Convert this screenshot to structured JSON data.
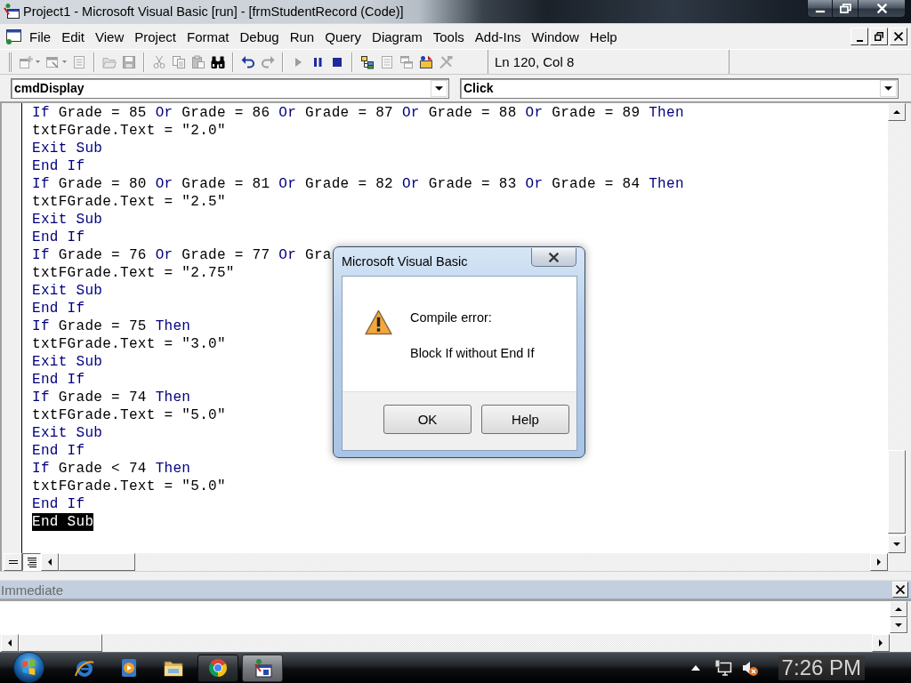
{
  "window": {
    "title": "Project1 - Microsoft Visual Basic [run] - [frmStudentRecord (Code)]"
  },
  "menu_bar": {
    "items": [
      "File",
      "Edit",
      "View",
      "Project",
      "Format",
      "Debug",
      "Run",
      "Query",
      "Diagram",
      "Tools",
      "Add-Ins",
      "Window",
      "Help"
    ]
  },
  "toolbar": {
    "groups": [
      [
        {
          "kind": "add-project",
          "disabled": true,
          "dropdown": true
        },
        {
          "kind": "add-form",
          "disabled": true,
          "dropdown": true
        },
        {
          "kind": "menu-editor",
          "disabled": true
        }
      ],
      [
        {
          "kind": "open",
          "disabled": true
        },
        {
          "kind": "save",
          "disabled": true
        }
      ],
      [
        {
          "kind": "cut",
          "disabled": true
        },
        {
          "kind": "copy",
          "disabled": true
        },
        {
          "kind": "paste",
          "disabled": true
        },
        {
          "kind": "find",
          "disabled": false
        }
      ],
      [
        {
          "kind": "undo",
          "disabled": false
        },
        {
          "kind": "redo",
          "disabled": true
        }
      ],
      [
        {
          "kind": "start",
          "disabled": true
        },
        {
          "kind": "break",
          "disabled": false
        },
        {
          "kind": "end",
          "disabled": false
        }
      ],
      [
        {
          "kind": "project-explorer",
          "disabled": false
        },
        {
          "kind": "properties",
          "disabled": true
        },
        {
          "kind": "form-layout",
          "disabled": true
        },
        {
          "kind": "object-browser",
          "disabled": false
        },
        {
          "kind": "toolbox",
          "disabled": true
        }
      ]
    ],
    "position": "Ln 120, Col 8"
  },
  "code_window": {
    "object": "cmdDisplay",
    "procedure": "Click",
    "lines": [
      {
        "selected": false,
        "parts": [
          {
            "kind": "keyword",
            "text": "If"
          },
          {
            "kind": "plain",
            "text": " Grade = 85 "
          },
          {
            "kind": "keyword",
            "text": "Or"
          },
          {
            "kind": "plain",
            "text": " Grade = 86 "
          },
          {
            "kind": "keyword",
            "text": "Or"
          },
          {
            "kind": "plain",
            "text": " Grade = 87 "
          },
          {
            "kind": "keyword",
            "text": "Or"
          },
          {
            "kind": "plain",
            "text": " Grade = 88 "
          },
          {
            "kind": "keyword",
            "text": "Or"
          },
          {
            "kind": "plain",
            "text": " Grade = 89 "
          },
          {
            "kind": "keyword",
            "text": "Then"
          }
        ]
      },
      {
        "selected": false,
        "parts": [
          {
            "kind": "plain",
            "text": "txtFGrade.Text = \"2.0\""
          }
        ]
      },
      {
        "selected": false,
        "parts": [
          {
            "kind": "keyword",
            "text": "Exit Sub"
          }
        ]
      },
      {
        "selected": false,
        "parts": [
          {
            "kind": "keyword",
            "text": "End If"
          }
        ]
      },
      {
        "selected": false,
        "parts": [
          {
            "kind": "keyword",
            "text": "If"
          },
          {
            "kind": "plain",
            "text": " Grade = 80 "
          },
          {
            "kind": "keyword",
            "text": "Or"
          },
          {
            "kind": "plain",
            "text": " Grade = 81 "
          },
          {
            "kind": "keyword",
            "text": "Or"
          },
          {
            "kind": "plain",
            "text": " Grade = 82 "
          },
          {
            "kind": "keyword",
            "text": "Or"
          },
          {
            "kind": "plain",
            "text": " Grade = 83 "
          },
          {
            "kind": "keyword",
            "text": "Or"
          },
          {
            "kind": "plain",
            "text": " Grade = 84 "
          },
          {
            "kind": "keyword",
            "text": "Then"
          }
        ]
      },
      {
        "selected": false,
        "parts": [
          {
            "kind": "plain",
            "text": "txtFGrade.Text = \"2.5\""
          }
        ]
      },
      {
        "selected": false,
        "parts": [
          {
            "kind": "keyword",
            "text": "Exit Sub"
          }
        ]
      },
      {
        "selected": false,
        "parts": [
          {
            "kind": "keyword",
            "text": "End If"
          }
        ]
      },
      {
        "selected": false,
        "parts": [
          {
            "kind": "keyword",
            "text": "If"
          },
          {
            "kind": "plain",
            "text": " Grade = 76 "
          },
          {
            "kind": "keyword",
            "text": "Or"
          },
          {
            "kind": "plain",
            "text": " Grade = 77 "
          },
          {
            "kind": "keyword",
            "text": "Or"
          },
          {
            "kind": "plain",
            "text": " Gra"
          }
        ]
      },
      {
        "selected": false,
        "parts": [
          {
            "kind": "plain",
            "text": "txtFGrade.Text = \"2.75\""
          }
        ]
      },
      {
        "selected": false,
        "parts": [
          {
            "kind": "keyword",
            "text": "Exit Sub"
          }
        ]
      },
      {
        "selected": false,
        "parts": [
          {
            "kind": "keyword",
            "text": "End If"
          }
        ]
      },
      {
        "selected": false,
        "parts": [
          {
            "kind": "keyword",
            "text": "If"
          },
          {
            "kind": "plain",
            "text": " Grade = 75 "
          },
          {
            "kind": "keyword",
            "text": "Then"
          }
        ]
      },
      {
        "selected": false,
        "parts": [
          {
            "kind": "plain",
            "text": "txtFGrade.Text = \"3.0\""
          }
        ]
      },
      {
        "selected": false,
        "parts": [
          {
            "kind": "keyword",
            "text": "Exit Sub"
          }
        ]
      },
      {
        "selected": false,
        "parts": [
          {
            "kind": "keyword",
            "text": "End If"
          }
        ]
      },
      {
        "selected": false,
        "parts": [
          {
            "kind": "keyword",
            "text": "If"
          },
          {
            "kind": "plain",
            "text": " Grade = 74 "
          },
          {
            "kind": "keyword",
            "text": "Then"
          }
        ]
      },
      {
        "selected": false,
        "parts": [
          {
            "kind": "plain",
            "text": "txtFGrade.Text = \"5.0\""
          }
        ]
      },
      {
        "selected": false,
        "parts": [
          {
            "kind": "keyword",
            "text": "Exit Sub"
          }
        ]
      },
      {
        "selected": false,
        "parts": [
          {
            "kind": "keyword",
            "text": "End If"
          }
        ]
      },
      {
        "selected": false,
        "parts": [
          {
            "kind": "keyword",
            "text": "If"
          },
          {
            "kind": "plain",
            "text": " Grade < 74 "
          },
          {
            "kind": "keyword",
            "text": "Then"
          }
        ]
      },
      {
        "selected": false,
        "parts": [
          {
            "kind": "plain",
            "text": "txtFGrade.Text = \"5.0\""
          }
        ]
      },
      {
        "selected": false,
        "parts": [
          {
            "kind": "keyword",
            "text": "End If"
          }
        ]
      },
      {
        "selected": true,
        "parts": [
          {
            "kind": "keyword",
            "text": "End Sub"
          }
        ]
      }
    ],
    "view_buttons": [
      {
        "kind": "procedure",
        "selected": false
      },
      {
        "kind": "module",
        "selected": true
      }
    ]
  },
  "immediate": {
    "title": "Immediate"
  },
  "dialog": {
    "title": "Microsoft Visual Basic",
    "heading": "Compile error:",
    "message": "Block If without End If",
    "buttons": [
      "OK",
      "Help"
    ]
  },
  "taskbar": {
    "tasks": [
      {
        "kind": "browser",
        "selected": false
      },
      {
        "kind": "ide",
        "selected": true
      }
    ],
    "clock": "7:26 PM"
  }
}
